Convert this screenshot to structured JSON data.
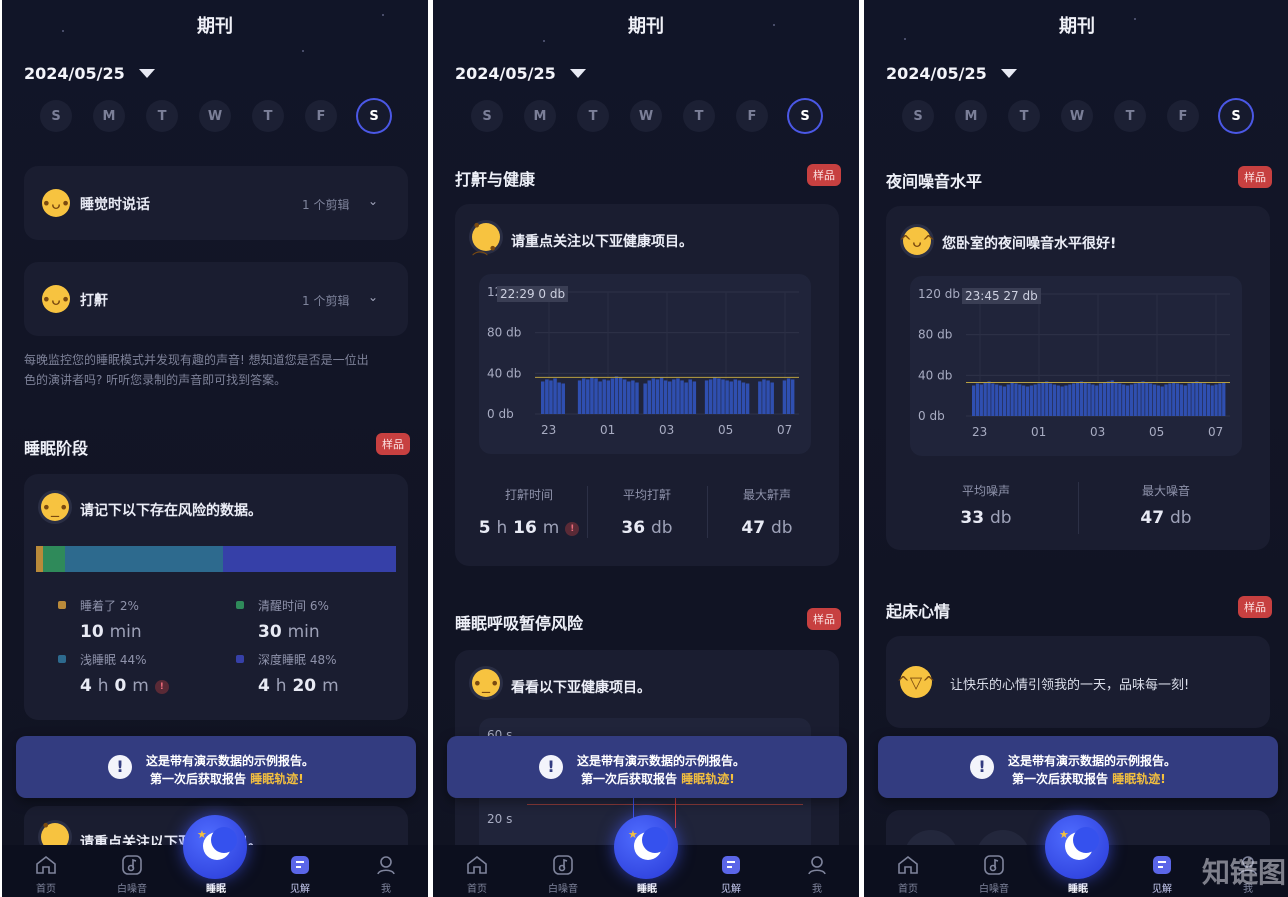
{
  "screens": [
    {
      "title": "期刊",
      "date": "2024/05/25",
      "week": [
        "S",
        "M",
        "T",
        "W",
        "T",
        "F",
        "S"
      ],
      "rows": [
        {
          "label": "睡觉时说话",
          "count": "1 个剪辑"
        },
        {
          "label": "打鼾",
          "count": "1 个剪辑"
        }
      ],
      "paragraph_line1": "每晚监控您的睡眠模式并发现有趣的声音! 想知道您是否是一位出",
      "paragraph_line2": "色的演讲者吗? 听听您录制的声音即可找到答案。",
      "section": "睡眠阶段",
      "badge": "样品",
      "headline": "请记下以下存在风险的数据。",
      "stages": [
        {
          "label": "睡着了 2%",
          "num1": "10",
          "unit1": "min",
          "num2": "",
          "unit2": "",
          "fraction": 0.02,
          "color": "#b98a3a"
        },
        {
          "label": "清醒时间 6%",
          "num1": "30",
          "unit1": "min",
          "num2": "",
          "unit2": "",
          "fraction": 0.06,
          "color": "#2f8a5a"
        },
        {
          "label": "浅睡眠 44%",
          "num1": "4",
          "unit1": "h",
          "num2": "0",
          "unit2": "m",
          "fraction": 0.44,
          "color": "#2d6a8e"
        },
        {
          "label": "深度睡眠 48%",
          "num1": "4",
          "unit1": "h",
          "num2": "20",
          "unit2": "m",
          "fraction": 0.48,
          "color": "#3640a8"
        }
      ],
      "warn_glyph": "!",
      "bottom_headline": "请重点关注以下亚健康项目。"
    },
    {
      "title": "期刊",
      "date": "2024/05/25",
      "week": [
        "S",
        "M",
        "T",
        "W",
        "T",
        "F",
        "S"
      ],
      "section": "打鼾与健康",
      "badge": "样品",
      "headline": "请重点关注以下亚健康项目。",
      "chart_tooltip": "22:29  0 db",
      "stats": [
        {
          "label": "打鼾时间",
          "n1": "5",
          "u1": "h",
          "n2": "16",
          "u2": "m"
        },
        {
          "label": "平均打鼾",
          "n1": "36",
          "u1": "db",
          "n2": "",
          "u2": ""
        },
        {
          "label": "最大鼾声",
          "n1": "47",
          "u1": "db",
          "n2": "",
          "u2": ""
        }
      ],
      "warn_glyph": "!",
      "section2": "睡眠呼吸暂停风险",
      "badge2": "样品",
      "headline2": "看看以下亚健康项目。",
      "chart2_y": [
        "60 s",
        "20 s"
      ]
    },
    {
      "title": "期刊",
      "date": "2024/05/25",
      "week": [
        "S",
        "M",
        "T",
        "W",
        "T",
        "F",
        "S"
      ],
      "section": "夜间噪音水平",
      "badge": "样品",
      "headline": "您卧室的夜间噪音水平很好!",
      "chart_tooltip": "23:45  27 db",
      "stats": [
        {
          "label": "平均噪声",
          "n1": "33",
          "u1": "db"
        },
        {
          "label": "最大噪音",
          "n1": "47",
          "u1": "db"
        }
      ],
      "section2": "起床心情",
      "badge2": "样品",
      "mood_text": "让快乐的心情引领我的一天，品味每一刻!",
      "watermark": "知链图"
    }
  ],
  "banner": {
    "glyph": "!",
    "line1": "这是带有演示数据的示例报告。",
    "line2_prefix": "第一次后获取报告 ",
    "line2_highlight": "睡眠轨迹!"
  },
  "tabs": [
    {
      "label": "首页",
      "icon": "home-icon"
    },
    {
      "label": "白噪音",
      "icon": "music-note-icon"
    },
    {
      "label": "睡眠",
      "icon": "moon-icon"
    },
    {
      "label": "见解",
      "icon": "insight-icon"
    },
    {
      "label": "我",
      "icon": "profile-icon"
    }
  ],
  "chart_data": [
    {
      "type": "bar",
      "y_ticks": [
        "120 db",
        "80 db",
        "40 db",
        "0 db"
      ],
      "x_ticks": [
        "23",
        "01",
        "03",
        "05",
        "07"
      ],
      "ylim": [
        0,
        120
      ],
      "threshold": 36,
      "series": [
        {
          "values": [
            32,
            34,
            33,
            35,
            31,
            30,
            0,
            0,
            0,
            33,
            35,
            34,
            36,
            35,
            32,
            34,
            33,
            35,
            37,
            36,
            34,
            32,
            33,
            31,
            0,
            30,
            33,
            35,
            34,
            36,
            33,
            32,
            34,
            35,
            33,
            31,
            34,
            32,
            0,
            0,
            33,
            34,
            36,
            35,
            34,
            33,
            32,
            34,
            33,
            31,
            30,
            0,
            0,
            32,
            34,
            33,
            31,
            0,
            0,
            33,
            35,
            34
          ]
        }
      ],
      "tooltip": "22:29  0 db"
    },
    {
      "type": "bar",
      "y_ticks": [
        "120 db",
        "80 db",
        "40 db",
        "0 db"
      ],
      "x_ticks": [
        "23",
        "01",
        "03",
        "05",
        "07"
      ],
      "ylim": [
        0,
        120
      ],
      "threshold": 33,
      "series": [
        {
          "values": [
            30,
            32,
            31,
            33,
            34,
            32,
            31,
            30,
            29,
            31,
            33,
            32,
            31,
            30,
            29,
            30,
            31,
            32,
            33,
            34,
            32,
            31,
            30,
            29,
            30,
            31,
            32,
            33,
            34,
            33,
            32,
            31,
            30,
            32,
            33,
            34,
            35,
            33,
            32,
            31,
            30,
            31,
            32,
            33,
            34,
            33,
            32,
            31,
            30,
            29,
            31,
            32,
            33,
            32,
            31,
            30,
            32,
            33,
            34,
            33,
            32,
            31,
            30,
            31,
            32,
            33
          ]
        }
      ],
      "tooltip": "23:45  27 db"
    }
  ]
}
